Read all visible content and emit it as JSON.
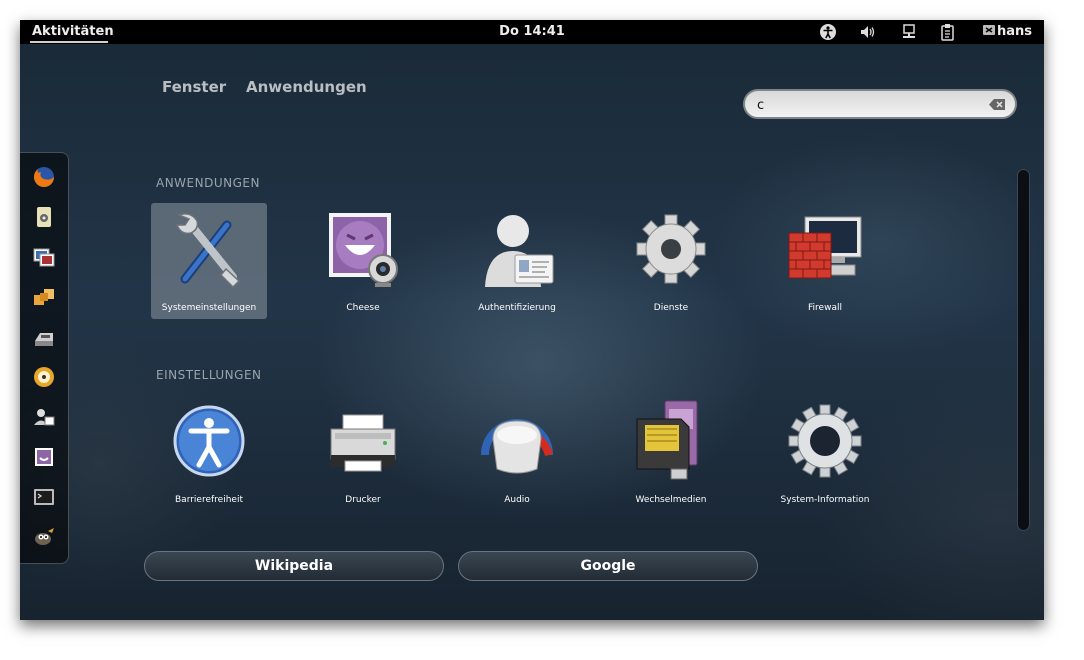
{
  "topbar": {
    "activities": "Aktivitäten",
    "clock": "Do 14:41",
    "user": "hans",
    "tray_icons": [
      "accessibility-icon",
      "volume-icon",
      "network-icon",
      "clipboard-icon",
      "user-status-icon"
    ]
  },
  "overview": {
    "tabs": [
      "Fenster",
      "Anwendungen"
    ],
    "search": {
      "value": "c"
    }
  },
  "dash": {
    "items": [
      "firefox-icon",
      "media-player-icon",
      "image-viewer-icon",
      "file-manager-icon",
      "printer-scanner-icon",
      "cd-burner-icon",
      "contacts-icon",
      "photo-booth-icon",
      "terminal-icon",
      "gimp-icon"
    ]
  },
  "sections": {
    "applications": {
      "title": "ANWENDUNGEN",
      "items": [
        {
          "label": "Systemeinstellungen",
          "icon": "settings-tools-icon",
          "selected": true
        },
        {
          "label": "Cheese",
          "icon": "cheese-webcam-icon"
        },
        {
          "label": "Authentifizierung",
          "icon": "authentication-icon"
        },
        {
          "label": "Dienste",
          "icon": "services-gear-icon"
        },
        {
          "label": "Firewall",
          "icon": "firewall-icon"
        }
      ]
    },
    "settings": {
      "title": "EINSTELLUNGEN",
      "items": [
        {
          "label": "Barrierefreiheit",
          "icon": "accessibility-icon"
        },
        {
          "label": "Drucker",
          "icon": "printer-icon"
        },
        {
          "label": "Audio",
          "icon": "audio-icon"
        },
        {
          "label": "Wechselmedien",
          "icon": "removable-media-icon"
        },
        {
          "label": "System-Information",
          "icon": "system-info-icon"
        }
      ]
    }
  },
  "providers": [
    "Wikipedia",
    "Google"
  ]
}
